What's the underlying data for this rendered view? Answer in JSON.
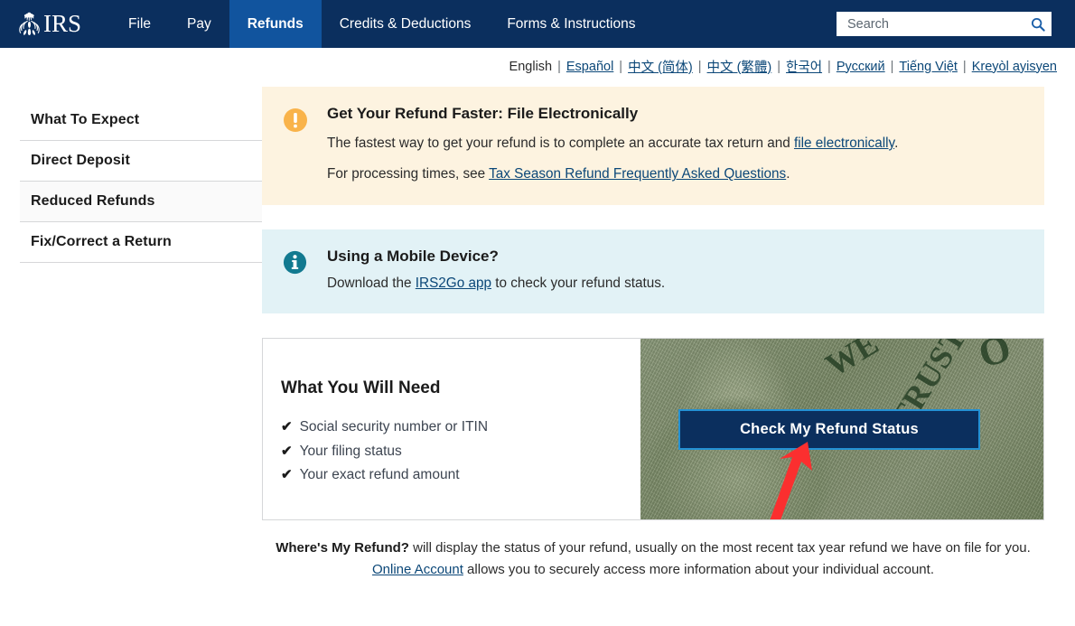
{
  "header": {
    "logo_text": "IRS",
    "logo_icon": "irs-eagle-scales-logo",
    "nav": [
      {
        "label": "File",
        "active": false
      },
      {
        "label": "Pay",
        "active": false
      },
      {
        "label": "Refunds",
        "active": true
      },
      {
        "label": "Credits & Deductions",
        "active": false
      },
      {
        "label": "Forms & Instructions",
        "active": false
      }
    ],
    "search": {
      "placeholder": "Search",
      "value": "",
      "icon": "search-icon"
    },
    "colors": {
      "header_bg": "#0b2f5e",
      "active_tab_bg": "#11549e"
    }
  },
  "language_bar": {
    "current": "English",
    "links": [
      "Español",
      "中文 (简体)",
      "中文 (繁體)",
      "한국어",
      "Русский",
      "Tiếng Việt",
      "Kreyòl ayisyen"
    ],
    "separator": "|"
  },
  "sidebar": {
    "items": [
      {
        "label": "What To Expect",
        "hovered": false
      },
      {
        "label": "Direct Deposit",
        "hovered": false
      },
      {
        "label": "Reduced Refunds",
        "hovered": true
      },
      {
        "label": "Fix/Correct a Return",
        "hovered": false
      }
    ]
  },
  "alerts": {
    "warning": {
      "icon": "exclamation-circle-icon",
      "icon_color": "#f9b34a",
      "bg_color": "#fdf3e0",
      "title": "Get Your Refund Faster: File Electronically",
      "paragraph1_pre": "The fastest way to get your refund is to complete an accurate tax return and ",
      "paragraph1_link": "file electronically",
      "paragraph1_post": ".",
      "paragraph2_pre": "For processing times, see ",
      "paragraph2_link": "Tax Season Refund Frequently Asked Questions",
      "paragraph2_post": "."
    },
    "info": {
      "icon": "info-circle-icon",
      "icon_color": "#127a90",
      "bg_color": "#e2f2f6",
      "title": "Using a Mobile Device?",
      "paragraph_pre": "Download the ",
      "paragraph_link": "IRS2Go app",
      "paragraph_post": " to check your refund status."
    }
  },
  "need_card": {
    "title": "What You Will Need",
    "check_glyph": "✔",
    "items": [
      "Social security number or ITIN",
      "Your filing status",
      "Your exact refund amount"
    ],
    "image": {
      "name": "dollar-bill-capitol-photo",
      "words": [
        "WE",
        "TRUST",
        "O"
      ]
    },
    "button": {
      "label": "Check My Refund Status",
      "bg_color": "#0b2f5e",
      "focus_ring_color": "#2491d4"
    },
    "arrow": {
      "name": "red-pointer-arrow",
      "color": "#fb2f2f"
    }
  },
  "footnote": {
    "line1_bold": "Where's My Refund?",
    "line1_rest": " will display the status of your refund, usually on the most recent tax year refund we have on file for you.",
    "line2_link": "Online Account",
    "line2_rest": " allows you to securely access more information about your individual account."
  }
}
